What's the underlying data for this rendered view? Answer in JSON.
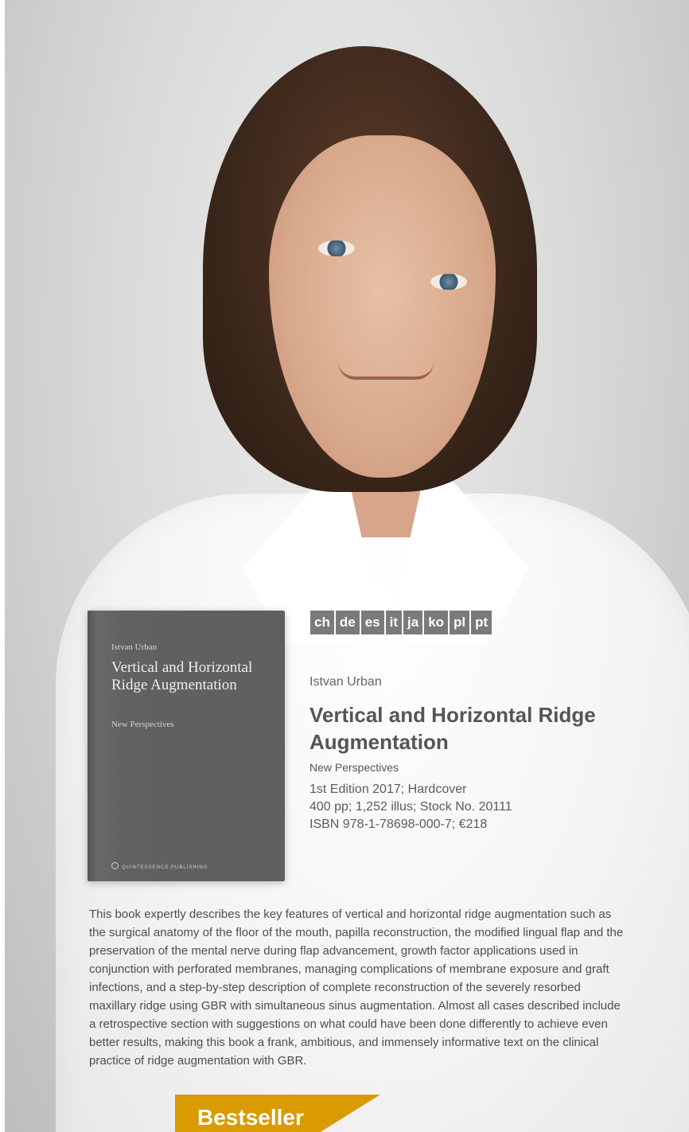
{
  "book_cover": {
    "author": "Istvan Urban",
    "title": "Vertical and Horizontal Ridge Augmentation",
    "subtitle": "New Perspectives",
    "publisher": "QUINTESSENCE PUBLISHING",
    "badge": "Bestseller"
  },
  "languages": [
    "ch",
    "de",
    "es",
    "it",
    "ja",
    "ko",
    "pl",
    "pt"
  ],
  "details": {
    "author": "Istvan Urban",
    "title": "Vertical and Horizontal Ridge Augmentation",
    "subtitle": "New Perspectives",
    "edition_line": "1st Edition 2017; Hardcover",
    "pages_line": "400 pp; 1,252 illus; Stock No. 20111",
    "isbn_line": "ISBN 978-1-78698-000-7; €218"
  },
  "description": "This book expertly describes the key features of vertical and horizontal ridge augmentation such as the surgical anatomy of the floor of the mouth, papilla reconstruction, the modified lingual flap and the preservation of the mental nerve during flap advancement, growth factor applications used in conjunction with perforated membranes, managing complications of membrane exposure and graft infections, and a step-by-step description of complete reconstruction of the severely resorbed maxillary ridge using GBR with simultaneous sinus augmentation. Almost all cases described include a retrospective section with suggestions on what could have been done differently to achieve even better results, making this book a frank, ambitious, and immensely informative text on the clinical practice of ridge augmentation with GBR.",
  "colors": {
    "accent": "#d99b00",
    "tag_bg": "#7a7a7a",
    "cover_bg": "#5f5f5f"
  }
}
